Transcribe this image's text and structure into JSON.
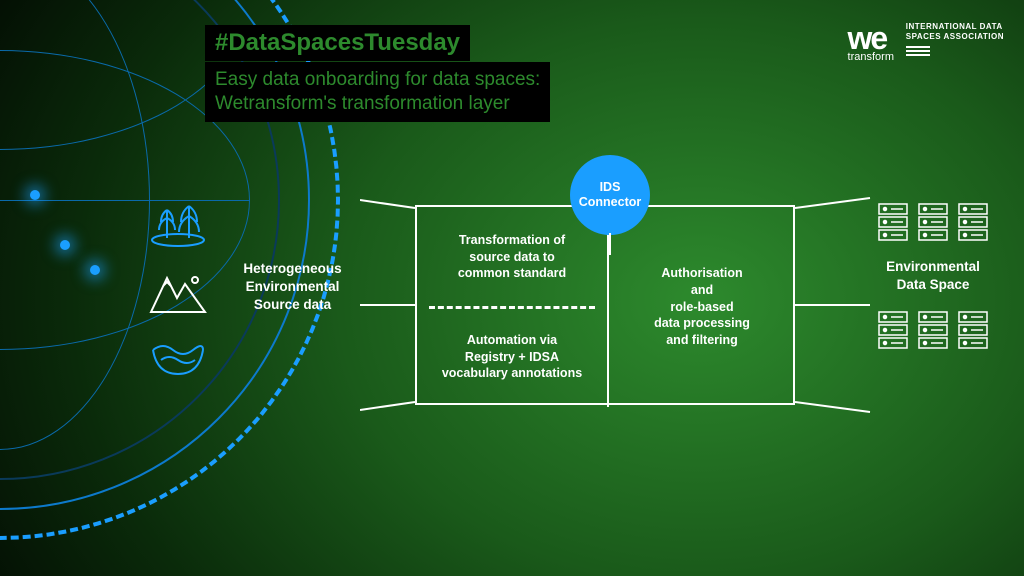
{
  "header": {
    "hashtag": "#DataSpacesTuesday",
    "subtitle_line1": "Easy data onboarding for data spaces:",
    "subtitle_line2": "Wetransform's transformation layer"
  },
  "logos": {
    "wetransform_mark": "we",
    "wetransform_word": "transform",
    "idsa_line1": "INTERNATIONAL DATA",
    "idsa_line2": "SPACES ASSOCIATION"
  },
  "diagram": {
    "source_label": "Heterogeneous\nEnvironmental\nSource data",
    "connector_line1": "IDS",
    "connector_line2": "Connector",
    "cell_transform": "Transformation of\nsource data to\ncommon standard",
    "cell_automation": "Automation via\nRegistry + IDSA\nvocabulary annotations",
    "cell_auth": "Authorisation\nand\nrole-based\ndata processing\nand filtering",
    "dataspace_label": "Environmental\nData Space"
  },
  "icons": {
    "trees": "trees-icon",
    "mountains": "mountains-icon",
    "waves": "waves-icon",
    "server": "server-icon"
  },
  "colors": {
    "accent_blue": "#1a9eff",
    "heading_green": "#2d8a2d"
  }
}
